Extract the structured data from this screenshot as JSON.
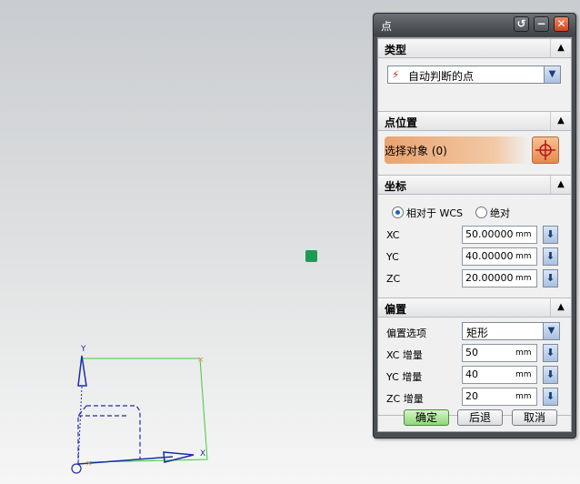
{
  "dialog": {
    "title": "点",
    "sections": {
      "type": {
        "title": "类型",
        "selected": "自动判断的点"
      },
      "point_location": {
        "title": "点位置",
        "select_object": "选择对象 (0)"
      },
      "coordinates": {
        "title": "坐标",
        "radio_relative": "相对于 WCS",
        "radio_absolute": "绝对",
        "radio_selected": "relative",
        "xc_label": "XC",
        "xc_value": "50.000000",
        "yc_label": "YC",
        "yc_value": "40.000000",
        "zc_label": "ZC",
        "zc_value": "20.000000",
        "unit": "mm"
      },
      "offset": {
        "title": "偏置",
        "offset_option_label": "偏置选项",
        "offset_option_value": "矩形",
        "xc_inc_label": "XC 增量",
        "xc_inc_value": "50",
        "yc_inc_label": "YC 增量",
        "yc_inc_value": "40",
        "zc_inc_label": "ZC 增量",
        "zc_inc_value": "20",
        "unit": "mm"
      }
    },
    "buttons": {
      "ok": "确定",
      "back": "后退",
      "cancel": "取消"
    }
  },
  "viewport": {
    "axis_x_label": "X",
    "axis_y_label": "Y",
    "colors": {
      "rectangle": "#3dcc3d",
      "axes": "#1a2fa8",
      "marker": "#1f9a55",
      "accent_orange": "#e8894d"
    }
  }
}
